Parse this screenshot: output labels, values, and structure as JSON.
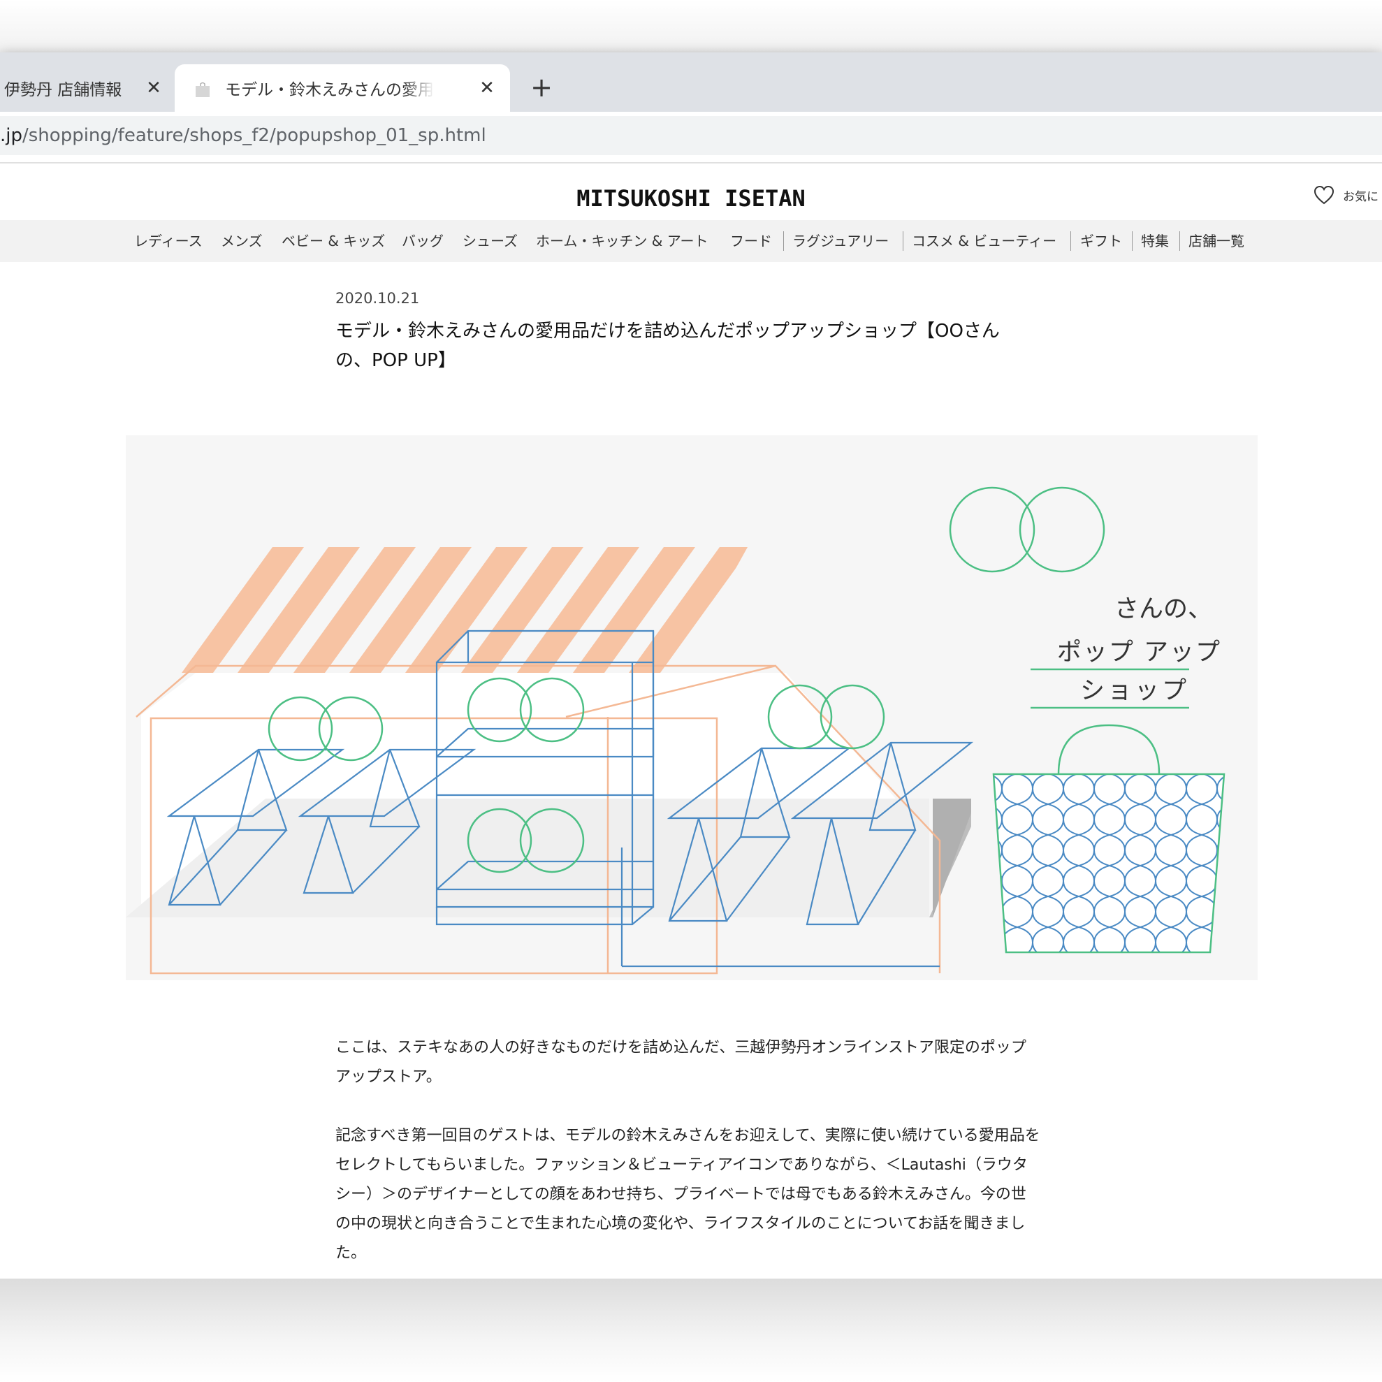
{
  "browser": {
    "tabs": [
      {
        "title": "伊勢丹 店舗情報",
        "active": false
      },
      {
        "title": "モデル・鈴木えみさんの愛用品だけを詰め込んだポップアップショップ",
        "active": true
      }
    ],
    "close_glyph": "✕",
    "new_tab_glyph": "+",
    "url_host": ".jp",
    "url_path": "/shopping/feature/shops_f2/popupshop_01_sp.html"
  },
  "header": {
    "logo": "MITSUKOSHI ISETAN",
    "favorites_label": "お気に",
    "favorites_icon": "heart-icon"
  },
  "nav": {
    "items": [
      "レディース",
      "メンズ",
      "ベビー & キッズ",
      "バッグ",
      "シューズ",
      "ホーム・キッチン & アート",
      "フード",
      "ラグジュアリー",
      "コスメ & ビューティー",
      "ギフト",
      "特集",
      "店舗一覧"
    ]
  },
  "article": {
    "date": "2020.10.21",
    "title": "モデル・鈴木えみさんの愛用品だけを詰め込んだポップアップショップ【OOさんの、POP UP】",
    "hero": {
      "caption_line1": "さんの、",
      "caption_line2": "ポップ アップ",
      "caption_line3": "ショップ"
    },
    "paragraphs": [
      "ここは、ステキなあの人の好きなものだけを詰め込んだ、三越伊勢丹オンラインストア限定のポップアップストア。",
      "記念すべき第一回目のゲストは、モデルの鈴木えみさんをお迎えして、実際に使い続けている愛用品をセレクトしてもらいました。ファッション＆ビューティアイコンでありながら、＜Lautashi（ラウタシー）＞のデザイナーとしての顔をあわせ持ち、プライベートでは母でもある鈴木えみさん。今の世の中の現状と向き合うことで生まれた心境の変化や、ライフスタイルのことについてお話を聞きました。"
    ]
  },
  "colors": {
    "stripe": "#f7c3a3",
    "house_line": "#f4b894",
    "shelf_line": "#4a8ac4",
    "ring": "#4cbf84",
    "shadow": "#bdbdbd"
  }
}
